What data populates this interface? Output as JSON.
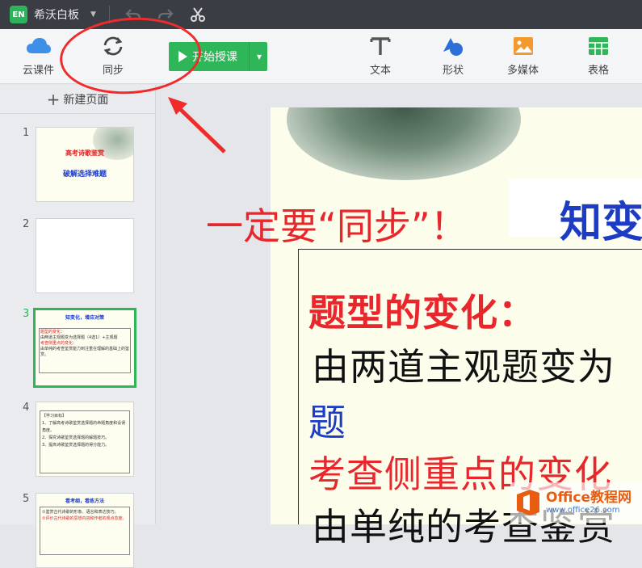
{
  "titlebar": {
    "logo_text": "EN",
    "app_title": "希沃白板"
  },
  "toolbar": {
    "cloud_label": "云课件",
    "sync_label": "同步",
    "start_label": "开始授课",
    "text_label": "文本",
    "shape_label": "形状",
    "media_label": "多媒体",
    "table_label": "表格"
  },
  "sidebar": {
    "new_page_label": "新建页面",
    "slides": [
      {
        "number": "1",
        "line1": "高考诗歌鉴赏",
        "line2": "破解选择难题"
      },
      {
        "number": "2"
      },
      {
        "number": "3",
        "title": "知变化，增应对策",
        "rows": [
          "题型的变化：",
          "由两道主观题变为选择题（4选1）+主观题",
          "考查侧重点的变化：",
          "由单纯的考查鉴赏能力到注重在理解的基础上的鉴赏。"
        ]
      },
      {
        "number": "4",
        "title": "【学习目标】",
        "rows": [
          "1、了解高考诗歌鉴赏选择题的命题角度和设误角度。",
          "2、探究诗歌鉴赏选择题的解题技巧。",
          "3、提高诗歌鉴赏选择题的得分能力。"
        ]
      },
      {
        "number": "5",
        "title": "看考纲，看练方法",
        "rows": [
          "①鉴赏古代诗歌的形象、语言和表达技巧。",
          "②评价古代诗歌的思想内容和作者的观点态度。"
        ]
      }
    ]
  },
  "slide": {
    "title": "知变",
    "line1": "题型的变化：",
    "line2": "由两道主观题变为",
    "line3": "题",
    "line4": "考查侧重点的变化",
    "line5": "由单纯的考查鉴赏"
  },
  "annotation": {
    "text": "一定要“同步”！"
  },
  "watermark": {
    "main": "Office教程网",
    "sub": "www.office26.com"
  },
  "colors": {
    "accent_green": "#2fb658",
    "annotation_red": "#e8262b",
    "slide_blue": "#1c3cc4",
    "titlebar": "#3a3d44"
  }
}
